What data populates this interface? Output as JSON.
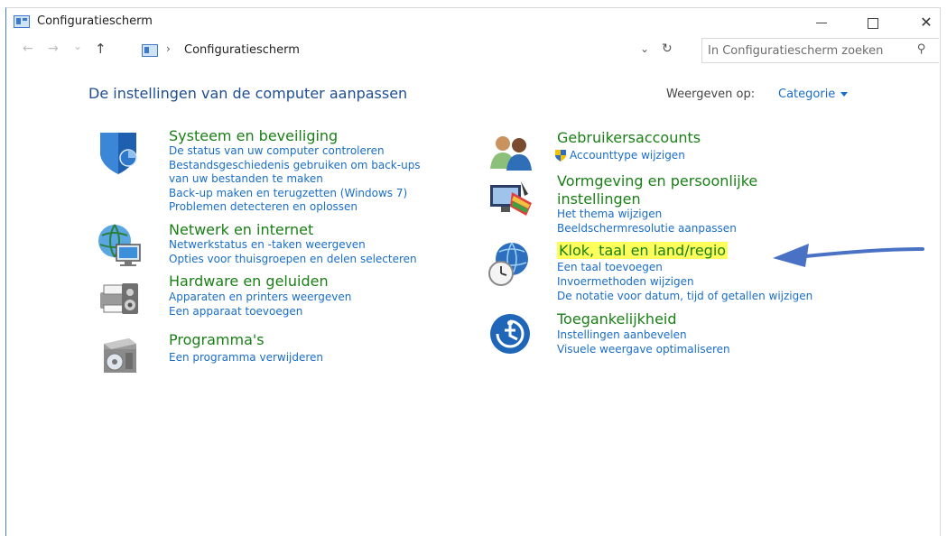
{
  "window": {
    "title": "Configuratiescherm",
    "controls": {
      "minimize": "minimize",
      "maximize": "maximize",
      "close": "✕"
    }
  },
  "navbar": {
    "breadcrumb": "Configuratiescherm",
    "search_placeholder": "In Configuratiescherm zoeken"
  },
  "main": {
    "title": "De instellingen van de computer aanpassen",
    "view_label": "Weergeven op:",
    "view_value": "Categorie"
  },
  "categories": [
    {
      "title": "Systeem en beveiliging",
      "icon": "shield-icon",
      "links": [
        "De status van uw computer controleren",
        "Bestandsgeschiedenis gebruiken om back-ups",
        "van uw bestanden te maken",
        "Back-up maken en terugzetten (Windows 7)",
        "Problemen detecteren en oplossen"
      ]
    },
    {
      "title": "Netwerk en internet",
      "icon": "network-globe-icon",
      "links": [
        "Netwerkstatus en -taken weergeven",
        "Opties voor thuisgroepen en delen selecteren"
      ]
    },
    {
      "title": "Hardware en geluiden",
      "icon": "printer-speaker-icon",
      "links": [
        "Apparaten en printers weergeven",
        "Een apparaat toevoegen"
      ]
    },
    {
      "title": "Programma's",
      "icon": "programs-disc-icon",
      "links": [
        "Een programma verwijderen"
      ]
    },
    {
      "title": "Gebruikersaccounts",
      "icon": "users-icon",
      "links": [
        "Accounttype wijzigen"
      ]
    },
    {
      "title": "Vormgeving en persoonlijke",
      "title2": "instellingen",
      "icon": "appearance-icon",
      "links": [
        "Het thema wijzigen",
        "Beeldschermresolutie aanpassen"
      ]
    },
    {
      "title": "Klok, taal en land/regio",
      "icon": "clock-globe-icon",
      "highlighted": true,
      "links": [
        "Een taal toevoegen",
        "Invoermethoden wijzigen",
        "De notatie voor datum, tijd of getallen wijzigen"
      ]
    },
    {
      "title": "Toegankelijkheid",
      "icon": "accessibility-icon",
      "links": [
        "Instellingen aanbevelen",
        "Visuele weergave optimaliseren"
      ]
    }
  ],
  "colors": {
    "category_title": "#1a7f16",
    "link": "#1a6dc7",
    "page_title": "#1e4e90",
    "highlight": "#ffff5c",
    "annotation_arrow": "#4a72c4"
  }
}
